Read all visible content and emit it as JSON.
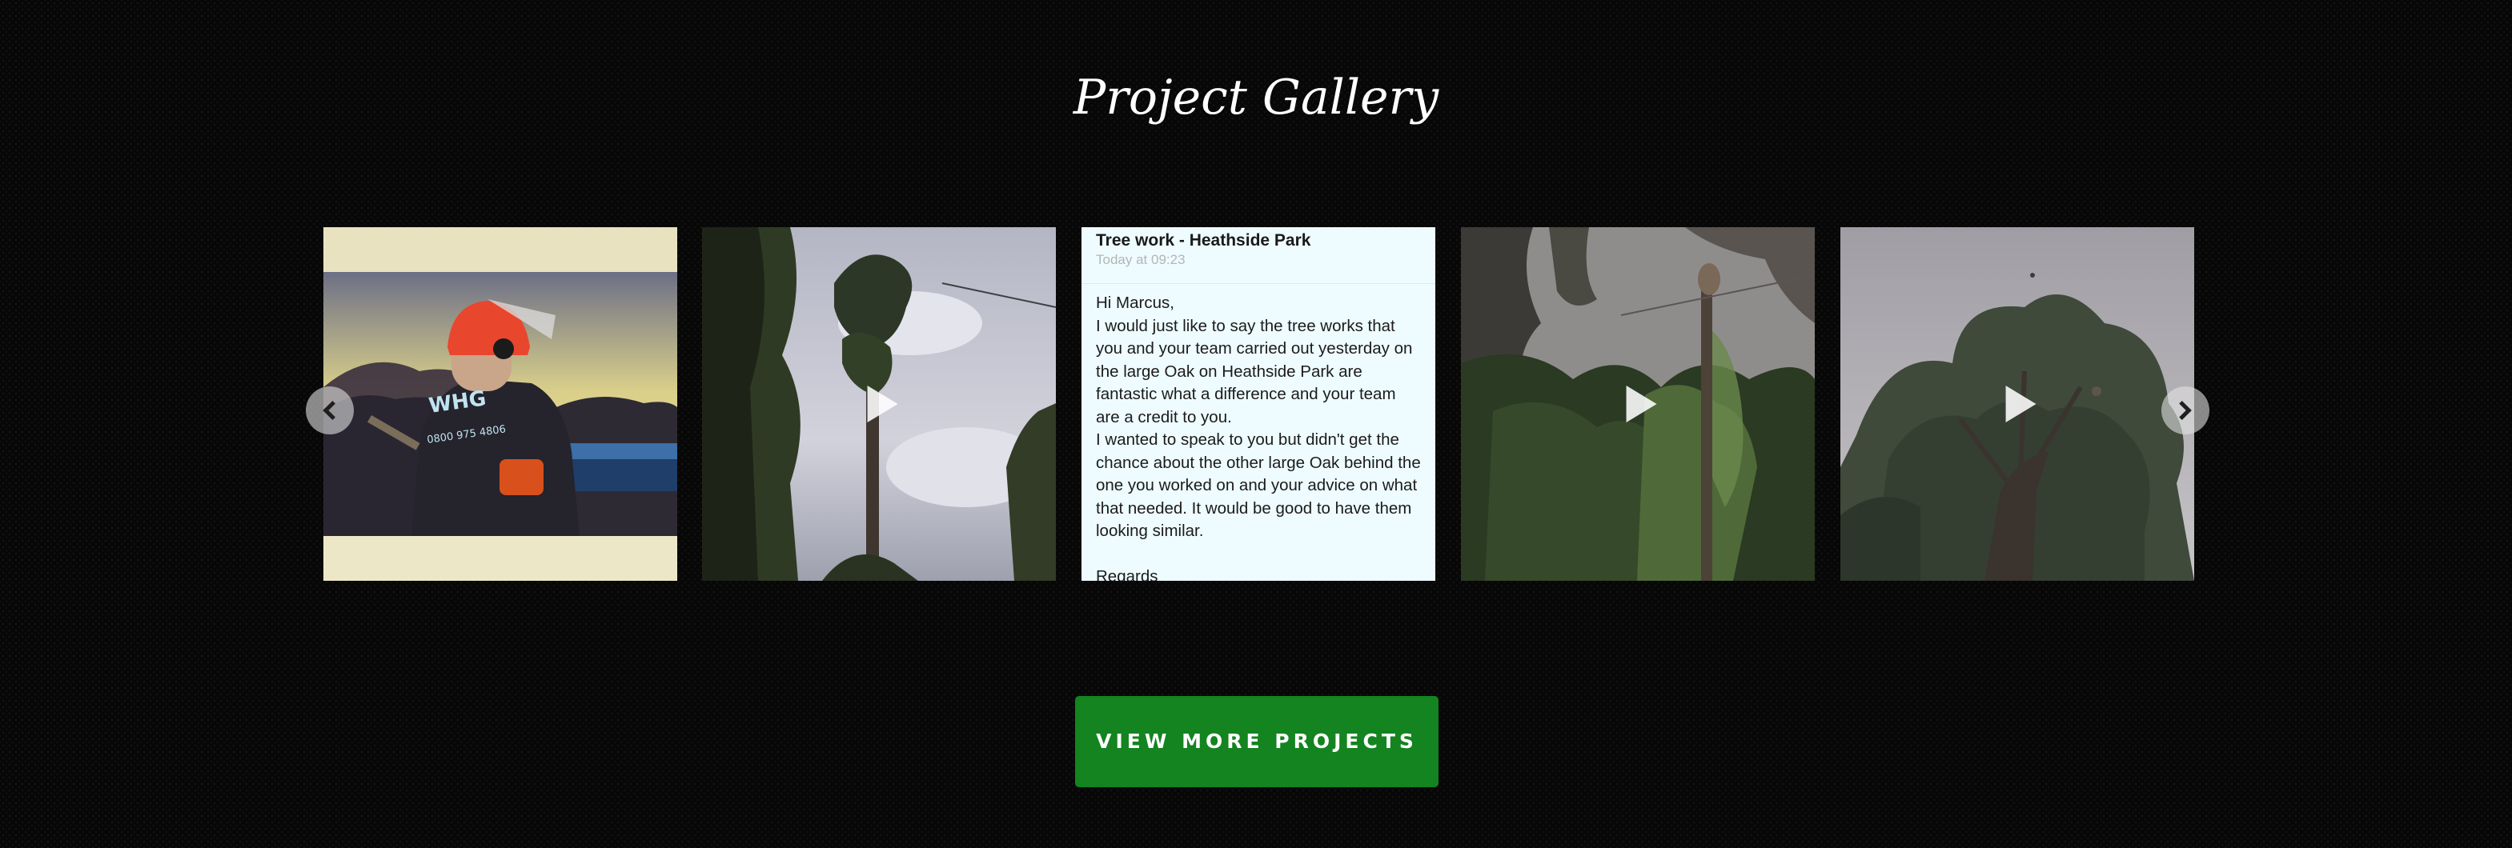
{
  "gallery": {
    "title": "Project Gallery",
    "prev_icon": "chevron-left-icon",
    "next_icon": "chevron-right-icon",
    "play_icon": "play-icon",
    "items": [
      {
        "type": "photo",
        "description": ""
      },
      {
        "type": "video"
      },
      {
        "type": "email",
        "subject": "Tree work - Heathside Park",
        "time": "Today at 09:23",
        "greeting": "Hi Marcus,",
        "paragraph1": "I would just like to say the tree works that you and your team carried out yesterday on the large Oak on Heathside Park are fantastic what a difference and your team are a credit to you.",
        "paragraph2": "I wanted to speak to you but didn't get the chance about the other large Oak behind the one you worked on and your advice on what that needed. It would be good to have them looking similar.",
        "signoff": "Regards"
      },
      {
        "type": "video"
      },
      {
        "type": "video"
      }
    ]
  },
  "photo_text": {
    "logo": "WHG",
    "phone": "0800 975 4806"
  },
  "cta": {
    "label": "VIEW MORE PROJECTS"
  },
  "colors": {
    "background": "#070707",
    "button": "#13841f",
    "email_bg": "#eefcff"
  }
}
